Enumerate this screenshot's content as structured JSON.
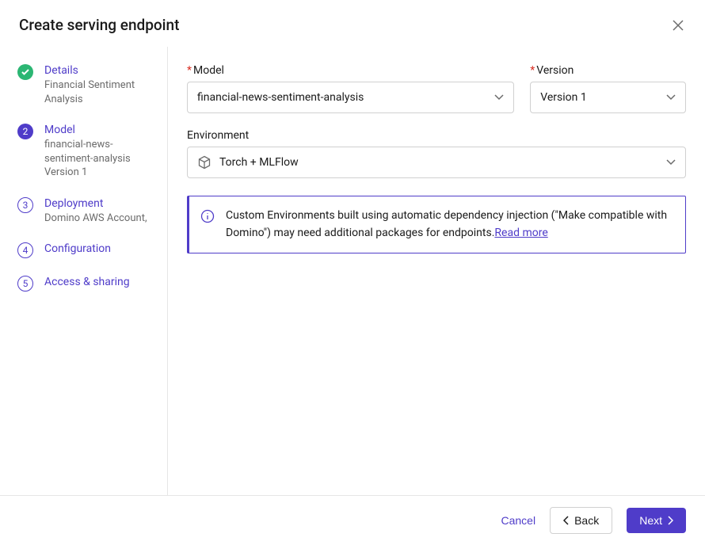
{
  "header": {
    "title": "Create serving endpoint"
  },
  "sidebar": {
    "steps": [
      {
        "num": "",
        "title": "Details",
        "sub": "Financial Sentiment Analysis",
        "state": "complete"
      },
      {
        "num": "2",
        "title": "Model",
        "sub": "financial-news-sentiment-analysis Version 1",
        "state": "active"
      },
      {
        "num": "3",
        "title": "Deployment",
        "sub": "Domino AWS Account,",
        "state": "upcoming"
      },
      {
        "num": "4",
        "title": "Configuration",
        "sub": "",
        "state": "upcoming"
      },
      {
        "num": "5",
        "title": "Access & sharing",
        "sub": "",
        "state": "upcoming"
      }
    ]
  },
  "form": {
    "model_label": "Model",
    "model_value": "financial-news-sentiment-analysis",
    "version_label": "Version",
    "version_value": "Version 1",
    "env_label": "Environment",
    "env_value": "Torch + MLFlow"
  },
  "info": {
    "text": "Custom Environments built using automatic dependency injection (\"Make compatible with Domino\") may need additional packages for endpoints.",
    "link": "Read more"
  },
  "footer": {
    "cancel": "Cancel",
    "back": "Back",
    "next": "Next"
  }
}
